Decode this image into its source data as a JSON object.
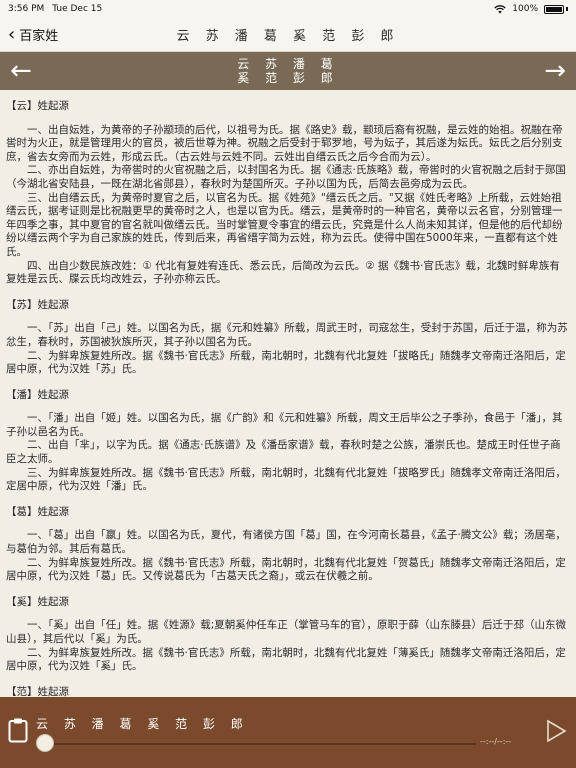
{
  "status": {
    "time": "3:56 PM",
    "date": "Tue Dec 15",
    "battery": "100%"
  },
  "nav": {
    "back_label": "百家姓",
    "title": "云 苏 潘 葛 奚 范 彭 郎"
  },
  "header": {
    "line1": "云 苏 潘 葛",
    "line2": "奚 范 彭 郎"
  },
  "sections": [
    {
      "title": "【云】姓起源",
      "paras": [
        "一、出自妘姓，为黄帝的子孙颛顼的后代，以祖号为氏。据《路史》载，颛顼后裔有祝融，是云姓的始祖。祝融在帝喾时为火正，就是管理用火的官员，被后世尊为神。祝融之后受封于郓罗地，号为妘子，其后遂为妘氏。妘氏之后分别支庶，省去女旁而为云姓，形成云氏。（古云姓与云姓不同。云姓出自缙云氏之后今合而为云）。",
        "二、亦出自妘姓，为帝喾时的火官祝融之后，以封国名为氏。据《通志·氏族略》载，帝喾时的火官祝融之后封于郧国（今湖北省安陆县，一既在湖北省郧县），春秋时为楚国所灭。子孙以国为氏，后简去邑旁成为云氏。",
        "三、出自缙云氏，为黄帝时夏官之后，以官名为氏。据《姓苑》\"缙云氏之后。\"又据《姓氏考略》上所载，云姓始祖缙云氏，据考证则是比祝融更早的黄帝时之人，也是以官为氏。缙云，是黄帝时的一种官名，黄帝以云名官，分别管理一年四季之事，其中夏官的官名就叫做缙云氏。当时掌管夏令事宜的缙云氏，究竟是什么人尚未知其详，但是他的后代却纷纷以缙云两个字为自己家族的姓氏，传到后来，再省缙字简为云姓，称为云氏。使得中国在5000年来，一直都有这个姓氏。",
        "四、出自少数民族改姓：① 代北有复姓宥连氏、悉云氏，后简改为云氏。② 据《魏书·官氏志》载，北魏时鲜卑族有复姓是云氏、牒云氏均改姓云，子孙亦称云氏。"
      ]
    },
    {
      "title": "【苏】姓起源",
      "paras": [
        "一、「苏」出自「己」姓。以国名为氏，据《元和姓纂》所载，周武王时，司寇忿生，受封于苏国，后迁于温，称为苏忿生，春秋时，苏国被狄族所灭，其子孙以国名为氏。",
        "二、为鲜卑族复姓所改。据《魏书·官氏志》所载，南北朝时，北魏有代北复姓「拔略氏」随魏孝文帝南迁洛阳后，定居中原，代为汉姓「苏」氏。"
      ]
    },
    {
      "title": "【潘】姓起源",
      "paras": [
        "一、「潘」出自「姬」姓。以国名为氏，据《广韵》和《元和姓纂》所载，周文王后毕公之子季孙，食邑于「潘」，其子孙以邑名为氏。",
        "二、出自「芈」，以字为氏。据《通志·氏族谱》及《潘岳家谱》载，春秋时楚之公族，潘崇氏也。楚成王时任世子商臣之太师。",
        "三、为鲜卑族复姓所改。据《魏书·官氏志》所载，南北朝时，北魏有代北复姓「拔略罗氏」随魏孝文帝南迁洛阳后，定居中原，代为汉姓「潘」氏。"
      ]
    },
    {
      "title": "【葛】姓起源",
      "paras": [
        "一、「葛」出自「嬴」姓。以国名为氏，夏代，有诸侯方国「葛」国，在今河南长葛县，《孟子·腾文公》载；汤居亳，与葛伯为邻。其后有葛氏。",
        "二、为鲜卑族复姓所改。据《魏书·官氏志》所载，南北朝时，北魏有代北复姓「贺葛氏」随魏孝文帝南迁洛阳后，定居中原，代为汉姓「葛」氏。又传说葛氏为「古葛天氏之裔」，或云在伏羲之前。"
      ]
    },
    {
      "title": "【奚】姓起源",
      "paras": [
        "一、「奚」出自「任」姓。据《姓源》载;夏朝奚仲任车正（掌管马车的官），原职于薛（山东滕县）后迁于邳（山东微山县），其后代以「奚」为氏。",
        "二、为鲜卑族复姓所改。据《魏书·官氏志》所载，南北朝时，北魏有代北复姓「薄奚氏」随魏孝文帝南迁洛阳后，定居中原，代为汉姓「奚」氏。"
      ]
    },
    {
      "title": "【范】姓起源",
      "paras": []
    }
  ],
  "player": {
    "title": "云 苏 潘 葛 奚 范 彭 郎",
    "time": "--:--/--:--",
    "progress": 0
  },
  "colors": {
    "header_bg": "#7a6a55",
    "player_bg": "#7b4a2c",
    "paper_bg": "#f1eee6"
  }
}
